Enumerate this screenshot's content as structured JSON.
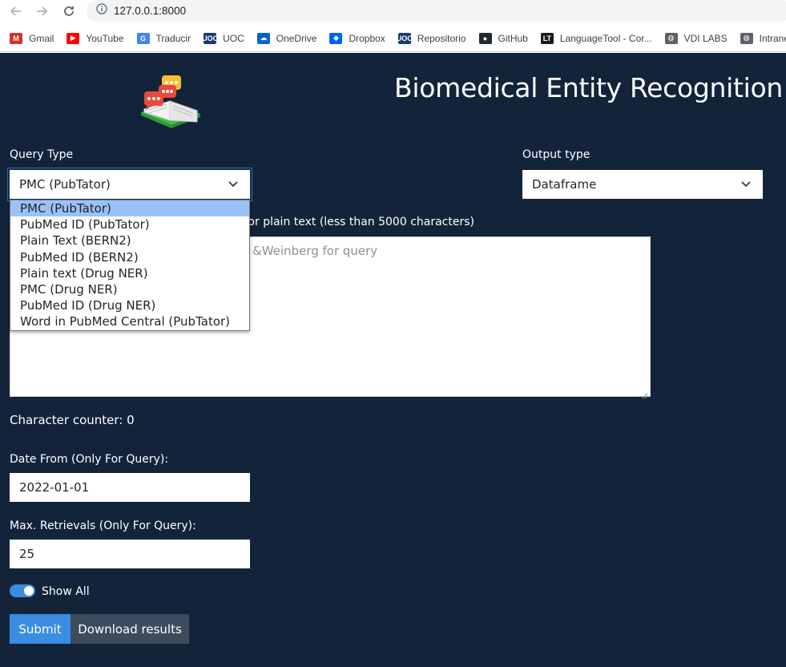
{
  "browser": {
    "url": "127.0.0.1:8000",
    "bookmarks": [
      {
        "label": "Gmail",
        "icon": "gmail-icon",
        "color": "#d93025",
        "glyph": "M"
      },
      {
        "label": "YouTube",
        "icon": "youtube-icon",
        "color": "#ff0000",
        "glyph": "▶"
      },
      {
        "label": "Traducir",
        "icon": "translate-icon",
        "color": "#4285f4",
        "glyph": "G"
      },
      {
        "label": "UOC",
        "icon": "uoc-icon",
        "color": "#1a3a6e",
        "glyph": "UOC"
      },
      {
        "label": "OneDrive",
        "icon": "onedrive-icon",
        "color": "#0a64c8",
        "glyph": "☁"
      },
      {
        "label": "Dropbox",
        "icon": "dropbox-icon",
        "color": "#0061fe",
        "glyph": "◆"
      },
      {
        "label": "Repositorio",
        "icon": "uoc-icon",
        "color": "#1a3a6e",
        "glyph": "UOC"
      },
      {
        "label": "GitHub",
        "icon": "github-icon",
        "color": "#24292f",
        "glyph": "●"
      },
      {
        "label": "LanguageTool - Cor...",
        "icon": "languagetool-icon",
        "color": "#1b1b1b",
        "glyph": "LT"
      },
      {
        "label": "VDI LABS",
        "icon": "globe-icon",
        "color": "#5f6368",
        "glyph": "◍"
      },
      {
        "label": "Intranet",
        "icon": "globe-icon",
        "color": "#5f6368",
        "glyph": "◍"
      }
    ]
  },
  "app": {
    "title": "Biomedical Entity Recognition",
    "query_type_label": "Query Type",
    "query_type_value": "PMC (PubTator)",
    "output_type_label": "Output type",
    "output_type_value": "Dataframe",
    "input_label_visible": "ord or plain text (less than 5000 characters)",
    "textarea_placeholder_visible": "&Weinberg for query",
    "char_counter": "Character counter: 0",
    "date_from_label": "Date From (Only For Query):",
    "date_from_value": "2022-01-01",
    "max_retrievals_label": "Max. Retrievals (Only For Query):",
    "max_retrievals_value": "25",
    "show_all_label": "Show All",
    "submit_label": "Submit",
    "download_label": "Download results",
    "query_type_options": [
      "PMC (PubTator)",
      "PubMed ID (PubTator)",
      "Plain Text (BERN2)",
      "PubMed ID (BERN2)",
      "Plain text (Drug NER)",
      "PMC (Drug NER)",
      "PubMed ID (Drug NER)",
      "Word in PubMed Central (PubTator)"
    ],
    "selected_option_index": 0,
    "show_all_on": true
  },
  "colors": {
    "background": "#13243a",
    "submit": "#3a8de0",
    "download": "#3d4b5c",
    "dropdown_highlight": "#99c2f7",
    "toggle": "#3a8de0"
  }
}
